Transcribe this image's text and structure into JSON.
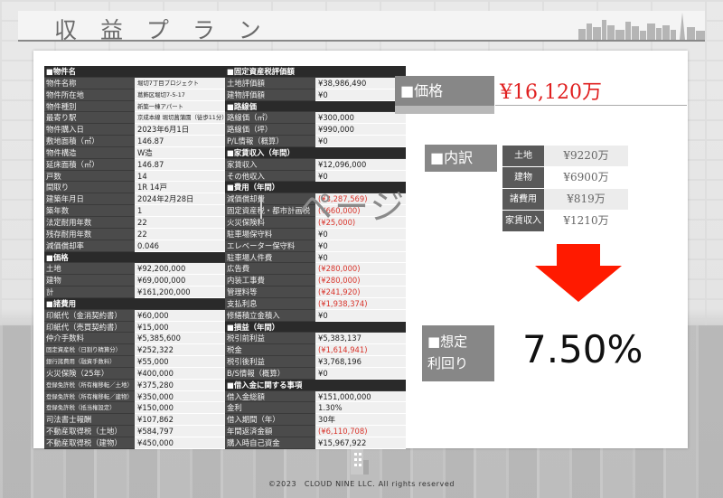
{
  "page_title": "収 益 プ ラ ン",
  "left_table": [
    {
      "header": "■物件名"
    },
    {
      "k": "物件名称",
      "v": "堀切7丁目プロジェクト",
      "vs": true
    },
    {
      "k": "物件所在地",
      "v": "葛飾区堀切7-5-17",
      "vs": true
    },
    {
      "k": "物件種別",
      "v": "新築一棟アパート",
      "vs": true
    },
    {
      "k": "最寄り駅",
      "v": "京成本線 堀切菖蒲園（徒歩11分）",
      "vs": true
    },
    {
      "k": "物件購入日",
      "v": "2023年6月1日"
    },
    {
      "k": "敷地面積（㎡）",
      "v": "146.87"
    },
    {
      "k": "物件構造",
      "v": "W造"
    },
    {
      "k": "延床面積（㎡）",
      "v": "146.87"
    },
    {
      "k": "戸数",
      "v": "14"
    },
    {
      "k": "間取り",
      "v": "1R 14戸"
    },
    {
      "k": "建築年月日",
      "v": "2024年2月28日"
    },
    {
      "k": "築年数",
      "v": "1"
    },
    {
      "k": "法定耐用年数",
      "v": "22"
    },
    {
      "k": "残存耐用年数",
      "v": "22"
    },
    {
      "k": "減価償却率",
      "v": "0.046"
    },
    {
      "header": "■価格"
    },
    {
      "k": "土地",
      "v": "¥92,200,000"
    },
    {
      "k": "建物",
      "v": "¥69,000,000"
    },
    {
      "k": "計",
      "v": "¥161,200,000"
    },
    {
      "header": "■諸費用"
    },
    {
      "k": "印紙代（金消契約書）",
      "v": "¥60,000"
    },
    {
      "k": "印紙代（売買契約書）",
      "v": "¥15,000"
    },
    {
      "k": "仲介手数料",
      "v": "¥5,385,600"
    },
    {
      "k": "固定資産税（日割り精算分）",
      "v": "¥252,322",
      "ks": true
    },
    {
      "k": "銀行諸費用（融資手数料）",
      "v": "¥55,000",
      "ks": true
    },
    {
      "k": "火災保険（25年）",
      "v": "¥400,000"
    },
    {
      "k": "登録免許税（所有権移転／土地）",
      "v": "¥375,280",
      "ks": true
    },
    {
      "k": "登録免許税（所有権移転／建物）",
      "v": "¥350,000",
      "ks": true
    },
    {
      "k": "登録免許税（抵当権設定）",
      "v": "¥150,000",
      "ks": true
    },
    {
      "k": "司法書士報酬",
      "v": "¥107,862"
    },
    {
      "k": "不動産取得税（土地）",
      "v": "¥584,797"
    },
    {
      "k": "不動産取得税（建物）",
      "v": "¥450,000"
    }
  ],
  "right_table": [
    {
      "header": "■固定資産税評価額"
    },
    {
      "k": "土地評価額",
      "v": "¥38,986,490"
    },
    {
      "k": "建物評価額",
      "v": "¥0"
    },
    {
      "header": "■路線価"
    },
    {
      "k": "路線価（㎡）",
      "v": "¥300,000"
    },
    {
      "k": "路線価（坪）",
      "v": "¥990,000"
    },
    {
      "k": "P/L情報（概算）",
      "v": "¥0"
    },
    {
      "header": "■家賃収入（年間）"
    },
    {
      "k": "家賃収入",
      "v": "¥12,096,000"
    },
    {
      "k": "その他収入",
      "v": "¥0"
    },
    {
      "header": "■費用（年間）"
    },
    {
      "k": "減価償却費",
      "v": "(¥3,287,569)",
      "red": true
    },
    {
      "k": "固定資産税・都市計画税",
      "v": "(¥660,000)",
      "red": true
    },
    {
      "k": "火災保険料",
      "v": "(¥25,000)",
      "red": true
    },
    {
      "k": "駐車場保守料",
      "v": "¥0"
    },
    {
      "k": "エレベーター保守料",
      "v": "¥0"
    },
    {
      "k": "駐車場人件費",
      "v": "¥0"
    },
    {
      "k": "広告費",
      "v": "(¥280,000)",
      "red": true
    },
    {
      "k": "内装工事費",
      "v": "(¥280,000)",
      "red": true
    },
    {
      "k": "管理料等",
      "v": "(¥241,920)",
      "red": true
    },
    {
      "k": "支払利息",
      "v": "(¥1,938,374)",
      "red": true
    },
    {
      "k": "修繕積立金積入",
      "v": "¥0"
    },
    {
      "header": "■損益（年間）"
    },
    {
      "k": "税引前利益",
      "v": "¥5,383,137"
    },
    {
      "k": "税金",
      "v": "(¥1,614,941)",
      "red": true
    },
    {
      "k": "税引後利益",
      "v": "¥3,768,196"
    },
    {
      "k": "B/S情報（概算）",
      "v": "¥0"
    },
    {
      "header": "■借入金に関する事項"
    },
    {
      "k": "借入金総額",
      "v": "¥151,000,000"
    },
    {
      "k": "金利",
      "v": "1.30%"
    },
    {
      "k": "借入期間（年）",
      "v": "30年"
    },
    {
      "k": "年間返済金額",
      "v": "(¥6,110,708)",
      "red": true
    },
    {
      "k": "購入時自己資金",
      "v": "¥15,967,922"
    }
  ],
  "watermark": "ページ",
  "price": {
    "label": "■価格",
    "value": "¥16,120万"
  },
  "breakdown": {
    "label": "■内訳",
    "rows": [
      {
        "k": "土地",
        "v": "¥9220万"
      },
      {
        "k": "建物",
        "v": "¥6900万"
      },
      {
        "k": "諸費用",
        "v": "¥819万"
      },
      {
        "k": "家賃収入",
        "v": "¥1210万"
      }
    ]
  },
  "yield": {
    "label_line1": "■想定",
    "label_line2": "利回り",
    "value": "7.50%"
  },
  "footer": "©2023　CLOUD NINE LLC. All rights reserved",
  "colors": {
    "accent_red": "#e02020",
    "label_gray": "#878787",
    "table_dark": "#4b4b4b"
  }
}
